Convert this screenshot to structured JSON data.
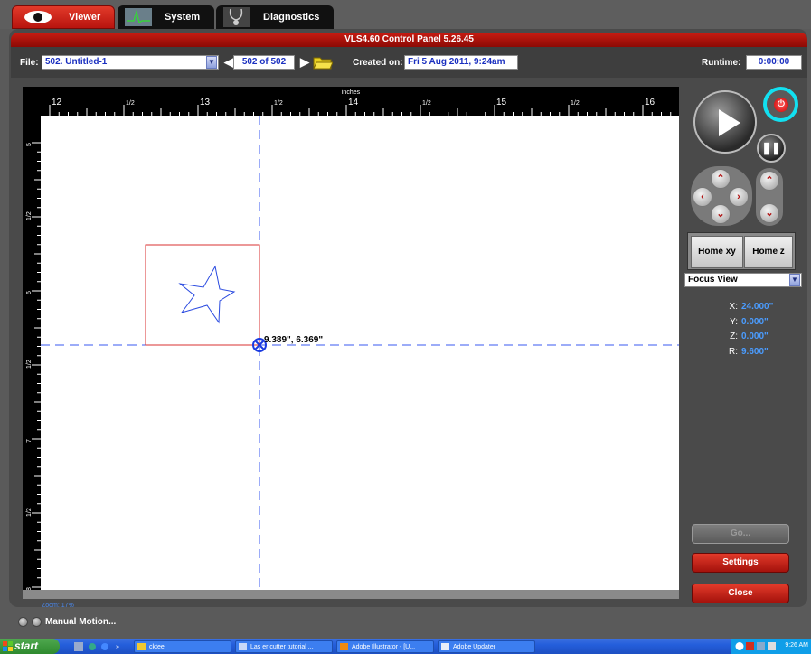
{
  "tabs": [
    {
      "label": "Viewer",
      "icon": "eye-icon",
      "active": true
    },
    {
      "label": "System",
      "icon": "system-graph-icon",
      "active": false
    },
    {
      "label": "Diagnostics",
      "icon": "stethoscope-icon",
      "active": false
    }
  ],
  "window": {
    "title": "VLS4.60  Control Panel  5.26.45"
  },
  "filebar": {
    "file_label": "File:",
    "file_value": "502. Untitled-1",
    "counter": "502 of 502",
    "created_label": "Created on:",
    "created_value": "Fri 5 Aug 2011,  9:24am",
    "runtime_label": "Runtime:",
    "runtime_value": "0:00:00"
  },
  "ruler": {
    "unit": "inches",
    "h_labels": [
      "12",
      "1/2",
      "13",
      "1/2",
      "14",
      "1/2",
      "15",
      "1/2",
      "16"
    ],
    "v_labels": [
      "5",
      "1/2",
      "6",
      "1/2",
      "7",
      "1/2",
      "8"
    ]
  },
  "canvas": {
    "cursor_label": "9.389\", 6.369\""
  },
  "zoom": "Zoom: 17%",
  "controls": {
    "home_xy": "Home xy",
    "home_z": "Home z",
    "focus_view": "Focus View",
    "coords": [
      {
        "label": "X:",
        "value": "24.000\""
      },
      {
        "label": "Y:",
        "value": "0.000\""
      },
      {
        "label": "Z:",
        "value": "0.000\""
      },
      {
        "label": "R:",
        "value": "9.600\""
      }
    ],
    "go": "Go...",
    "settings": "Settings",
    "close": "Close"
  },
  "manual_motion": "Manual Motion...",
  "taskbar": {
    "start": "start",
    "items": [
      {
        "label": "cktee",
        "icon": "folder-icon"
      },
      {
        "label": "Las er cutter tutorial ...",
        "icon": "word-doc-icon"
      },
      {
        "label": "Adobe Illustrator - [U...",
        "icon": "illustrator-icon"
      },
      {
        "label": "Adobe Updater",
        "icon": "mail-icon"
      }
    ],
    "clock": "9:26 AM"
  },
  "colors": {
    "accent_red": "#c81c12",
    "value_blue": "#1a2fc0",
    "highlight_cyan": "#12e0f0"
  }
}
